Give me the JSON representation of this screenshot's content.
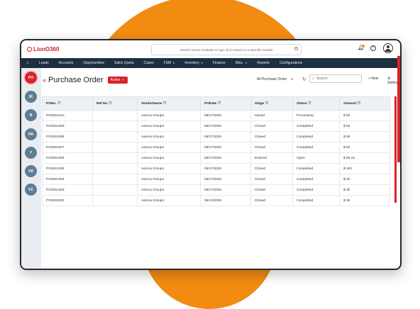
{
  "app": {
    "logo_text": "LionO360"
  },
  "topbar": {
    "search_placeholder": "Search across modules or type @ to search in a specific module"
  },
  "nav": {
    "items": [
      {
        "label": "Leads",
        "caret": false
      },
      {
        "label": "Accounts",
        "caret": false
      },
      {
        "label": "Opportunities",
        "caret": false
      },
      {
        "label": "Sales Quota",
        "caret": false
      },
      {
        "label": "Cases",
        "caret": false
      },
      {
        "label": "FSM",
        "caret": true
      },
      {
        "label": "Inventory",
        "caret": true
      },
      {
        "label": "Finance",
        "caret": false
      },
      {
        "label": "Misc.",
        "caret": true
      },
      {
        "label": "Reports",
        "caret": false
      },
      {
        "label": "Configurations",
        "caret": false
      }
    ]
  },
  "sidebar": {
    "items": [
      "PO",
      "IR",
      "B",
      "PR",
      "Y",
      "VR",
      "VC"
    ]
  },
  "page": {
    "title": "Purchase Order",
    "status": "Active",
    "view": "All Purchase Order",
    "search_placeholder": "Search",
    "new_label": "+ New",
    "settings_label": "Settings"
  },
  "table": {
    "columns": [
      "PONo.",
      "Ref No",
      "VendorName",
      "PODate",
      "Stage",
      "Status",
      "Amount"
    ],
    "rows": [
      [
        "PO2501310",
        "",
        "Aamca Groups",
        "06/17/2025",
        "Issued",
        "Processing",
        "$ 50"
      ],
      [
        "PO2501309",
        "",
        "Aamca Groups",
        "06/17/2025",
        "Closed",
        "Completed",
        "$ 50"
      ],
      [
        "PO2501308",
        "",
        "Aamca Groups",
        "06/17/2025",
        "Closed",
        "Completed",
        "$ 55"
      ],
      [
        "PO2501307",
        "",
        "Aamca Groups",
        "06/17/2025",
        "Closed",
        "Completed",
        "$ 50"
      ],
      [
        "PO2501306",
        "",
        "Aamca Groups",
        "06/17/2025",
        "Entered",
        "Open",
        "$ 56.16"
      ],
      [
        "PO2501305",
        "",
        "Aamca Groups",
        "06/17/2025",
        "Closed",
        "Completed",
        "$ 100"
      ],
      [
        "PO2501304",
        "",
        "Aamca Groups",
        "06/17/2025",
        "Closed",
        "Completed",
        "$ 30"
      ],
      [
        "PO2501303",
        "",
        "Aamca Groups",
        "06/17/2025",
        "Closed",
        "Completed",
        "$ 30"
      ],
      [
        "PO2501302",
        "",
        "Aamca Groups",
        "06/13/2025",
        "Closed",
        "Completed",
        "$ 30"
      ]
    ]
  },
  "colors": {
    "brand_red": "#d9232a",
    "orange": "#f28b12",
    "nav_bg": "#1e2f3f",
    "sidebar_btn": "#5f7c93"
  }
}
